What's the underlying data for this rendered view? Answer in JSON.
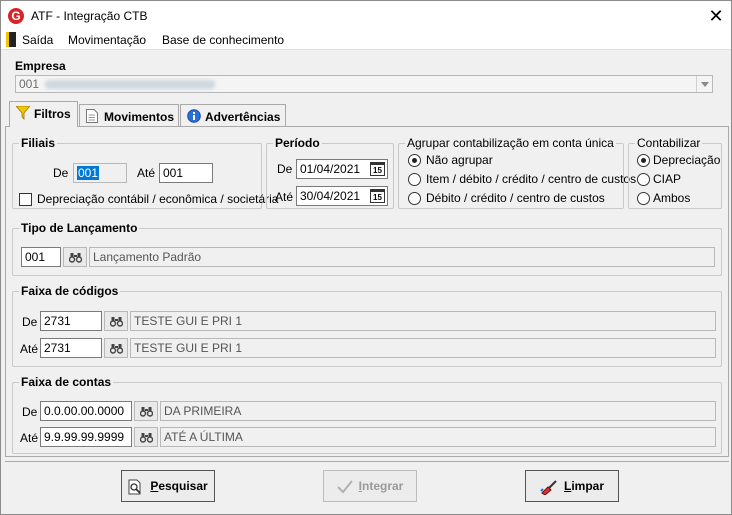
{
  "window": {
    "title": "ATF - Integração CTB",
    "logo_letter": "G"
  },
  "menu": {
    "exit": "Saída",
    "movements": "Movimentação",
    "knowledge_base": "Base de conhecimento"
  },
  "empresa": {
    "label": "Empresa",
    "value_code": "001"
  },
  "tabs": [
    {
      "label": "Filtros",
      "active": true
    },
    {
      "label": "Movimentos",
      "active": false
    },
    {
      "label": "Advertências",
      "active": false
    }
  ],
  "filiais": {
    "title": "Filiais",
    "from_label": "De",
    "from_value": "001",
    "to_label": "Até",
    "to_value": "001",
    "checkbox_label": "Depreciação contábil / econômica / societária"
  },
  "periodo": {
    "title": "Período",
    "from_label": "De",
    "from_value": "01/04/2021",
    "to_label": "Até",
    "to_value": "30/04/2021",
    "calendar_glyph": "15"
  },
  "agrupar": {
    "title": "Agrupar contabilização em conta única",
    "options": [
      "Não agrupar",
      "Item / débito / crédito / centro de custos",
      "Débito / crédito / centro de custos"
    ],
    "selected_index": 0
  },
  "contabilizar": {
    "title": "Contabilizar",
    "options": [
      "Depreciação",
      "CIAP",
      "Ambos"
    ],
    "selected_index": 0
  },
  "tipo_lancamento": {
    "title": "Tipo de Lançamento",
    "code": "001",
    "description": "Lançamento Padrão"
  },
  "faixa_codigos": {
    "title": "Faixa de códigos",
    "from_label": "De",
    "from_code": "2731",
    "from_desc": "TESTE GUI E PRI 1",
    "to_label": "Até",
    "to_code": "2731",
    "to_desc": "TESTE GUI E PRI 1"
  },
  "faixa_contas": {
    "title": "Faixa de contas",
    "from_label": "De",
    "from_code": "0.0.00.00.0000",
    "from_desc": "DA PRIMEIRA",
    "to_label": "Até",
    "to_code": "9.9.99.99.9999",
    "to_desc": "ATÉ A ÚLTIMA"
  },
  "buttons": {
    "search": {
      "mnemonic": "P",
      "rest": "esquisar"
    },
    "integrate": {
      "mnemonic": "I",
      "rest": "ntegrar"
    },
    "clear": {
      "mnemonic": "L",
      "rest": "impar"
    }
  },
  "colors": {
    "accent": "#0078d7",
    "logo": "#d8232a",
    "filter_icon": "#f3c400"
  }
}
